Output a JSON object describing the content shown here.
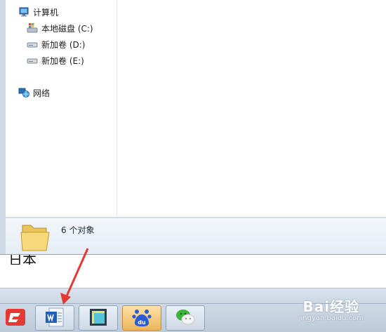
{
  "navigation": {
    "computer": "计算机",
    "drives": [
      "本地磁盘 (C:)",
      "新加卷 (D:)",
      "新加卷 (E:)"
    ],
    "network": "网络"
  },
  "status": {
    "item_count": "6 个对象"
  },
  "document": {
    "snippet": "日本"
  },
  "watermark": {
    "main": "Bai经验",
    "sub": "jingyan.baidu.com"
  },
  "icons": {
    "computer": "computer-icon",
    "system_drive": "windows-drive-icon",
    "drive": "hard-drive-icon",
    "network": "network-globe-icon",
    "folder": "folder-icon",
    "taskbar": [
      "wps-icon",
      "word-icon",
      "generic-app-icon",
      "baidu-du-icon",
      "wechat-icon"
    ]
  },
  "colors": {
    "accent_arrow": "#e53935",
    "active_task": "#f0b458",
    "window_frame": "#cfd9e6"
  }
}
